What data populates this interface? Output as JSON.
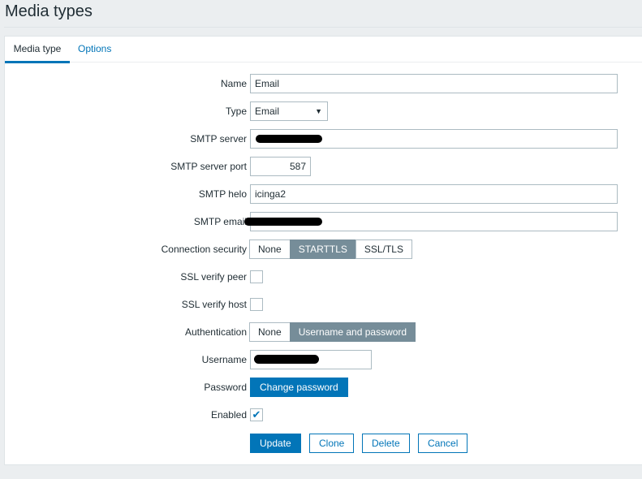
{
  "page": {
    "title": "Media types"
  },
  "tabs": [
    {
      "label": "Media type",
      "active": true
    },
    {
      "label": "Options",
      "active": false
    }
  ],
  "form": {
    "name": {
      "label": "Name",
      "value": "Email"
    },
    "type": {
      "label": "Type",
      "value": "Email",
      "icon": "dropdown-arrow-icon"
    },
    "smtp_server": {
      "label": "SMTP server"
    },
    "smtp_port": {
      "label": "SMTP server port",
      "value": "587"
    },
    "smtp_helo": {
      "label": "SMTP helo",
      "value": "icinga2"
    },
    "smtp_email": {
      "label": "SMTP email"
    },
    "connection_security": {
      "label": "Connection security",
      "options": [
        "None",
        "STARTTLS",
        "SSL/TLS"
      ],
      "selected": "STARTTLS"
    },
    "ssl_verify_peer": {
      "label": "SSL verify peer",
      "checked": false
    },
    "ssl_verify_host": {
      "label": "SSL verify host",
      "checked": false
    },
    "authentication": {
      "label": "Authentication",
      "options": [
        "None",
        "Username and password"
      ],
      "selected": "Username and password"
    },
    "username": {
      "label": "Username"
    },
    "password": {
      "label": "Password",
      "button": "Change password"
    },
    "enabled": {
      "label": "Enabled",
      "checked": true,
      "mark": "✔"
    }
  },
  "buttons": {
    "update": "Update",
    "clone": "Clone",
    "delete": "Delete",
    "cancel": "Cancel"
  },
  "colors": {
    "accent": "#0275b8",
    "selected_segment": "#768d99",
    "background": "#ebeef0"
  }
}
